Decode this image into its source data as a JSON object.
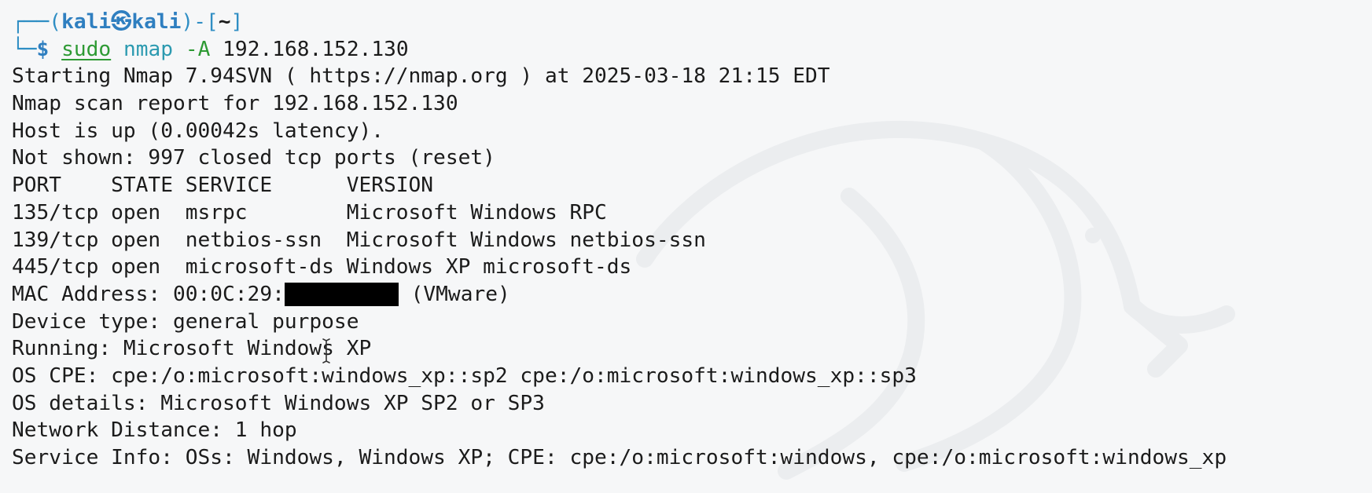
{
  "prompt": {
    "line1_open": "┌──(",
    "user": "kali",
    "at_symbol": "㉿",
    "host": "kali",
    "line1_mid": ")-[",
    "dir": "~",
    "line1_close": "]",
    "line2_corner": "└─",
    "dollar": "$",
    "cmd_sudo": "sudo",
    "cmd_nmap": "nmap",
    "cmd_flag": "-A",
    "cmd_target": "192.168.152.130"
  },
  "output": {
    "starting": "Starting Nmap 7.94SVN ( https://nmap.org ) at 2025-03-18 21:15 EDT",
    "report": "Nmap scan report for 192.168.152.130",
    "host_up": "Host is up (0.00042s latency).",
    "not_shown": "Not shown: 997 closed tcp ports (reset)",
    "header": "PORT    STATE SERVICE      VERSION",
    "ports": [
      "135/tcp open  msrpc        Microsoft Windows RPC",
      "139/tcp open  netbios-ssn  Microsoft Windows netbios-ssn",
      "445/tcp open  microsoft-ds Windows XP microsoft-ds"
    ],
    "mac_prefix": "MAC Address: 00:0C:29:",
    "mac_suffix": " (VMware)",
    "device_type": "Device type: general purpose",
    "running": "Running: Microsoft Windows XP",
    "os_cpe": "OS CPE: cpe:/o:microsoft:windows_xp::sp2 cpe:/o:microsoft:windows_xp::sp3",
    "os_details": "OS details: Microsoft Windows XP SP2 or SP3",
    "network_distance": "Network Distance: 1 hop",
    "service_info": "Service Info: OSs: Windows, Windows XP; CPE: cpe:/o:microsoft:windows, cpe:/o:microsoft:windows_xp"
  },
  "icons": {
    "background": "kali-dragon-watermark",
    "cursor": "text-cursor-icon"
  },
  "colors": {
    "background": "#f6f7f8",
    "text": "#1b1b1b",
    "prompt_blue": "#2f7fc0",
    "command_green": "#2e9a34",
    "command_cyan": "#2c9ab0",
    "redaction": "#000000"
  }
}
